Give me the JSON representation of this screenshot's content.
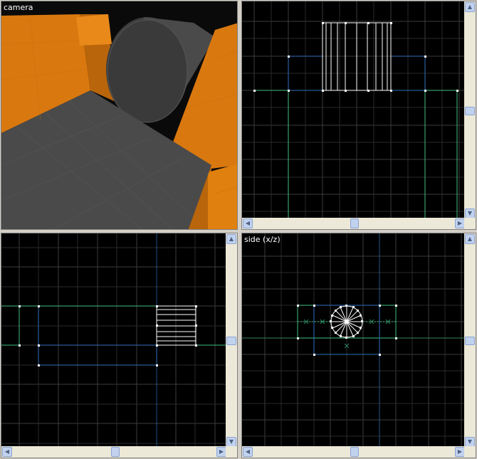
{
  "viewports": {
    "camera": {
      "label": "camera"
    },
    "top": {
      "label": ""
    },
    "front": {
      "label": ""
    },
    "side": {
      "label": "side (x/z)"
    }
  },
  "icons": {
    "scroll_up": "▲",
    "scroll_down": "▼",
    "scroll_left": "◀",
    "scroll_right": "▶"
  },
  "colors": {
    "grid": "#3d3d3d",
    "axis_green": "#40c080",
    "axis_blue": "#3070c0",
    "brush_orange": "#e07f0f",
    "brush_gray": "#4a4a4a",
    "selection": "#ffffff"
  }
}
